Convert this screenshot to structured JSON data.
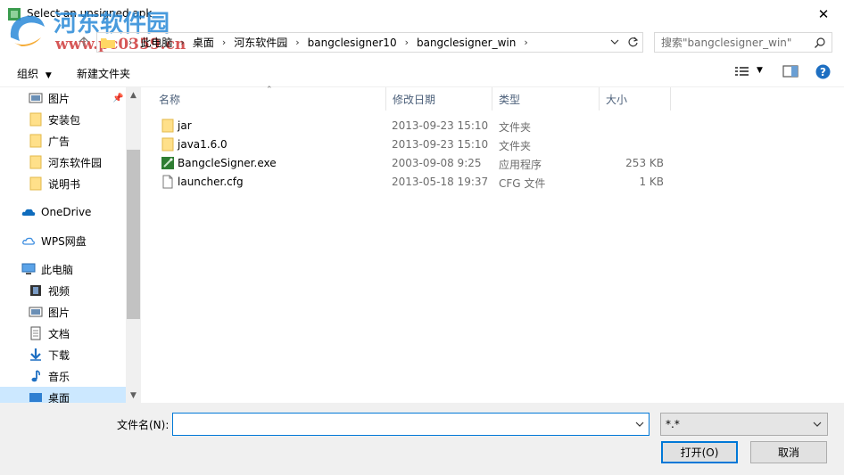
{
  "window": {
    "title": "Select an unsigned apk",
    "close_label": "✕"
  },
  "watermark": {
    "brand": "河东软件园",
    "url": "www.pc0359.cn"
  },
  "navigation": {
    "breadcrumbs": [
      "此电脑",
      "桌面",
      "河东软件园",
      "bangclesigner10",
      "bangclesigner_win"
    ],
    "search_placeholder": "搜索\"bangclesigner_win\""
  },
  "toolbar": {
    "organize_label": "组织",
    "new_folder_label": "新建文件夹"
  },
  "sidebar": {
    "items": [
      {
        "label": "图片",
        "icon": "pictures-icon"
      },
      {
        "label": "安装包",
        "icon": "folder-icon"
      },
      {
        "label": "广告",
        "icon": "folder-icon"
      },
      {
        "label": "河东软件园",
        "icon": "folder-icon"
      },
      {
        "label": "说明书",
        "icon": "folder-icon"
      },
      {
        "label": "OneDrive",
        "icon": "onedrive-icon"
      },
      {
        "label": "WPS网盘",
        "icon": "cloud-icon"
      },
      {
        "label": "此电脑",
        "icon": "computer-icon"
      },
      {
        "label": "视频",
        "icon": "video-icon"
      },
      {
        "label": "图片",
        "icon": "pictures-icon"
      },
      {
        "label": "文档",
        "icon": "documents-icon"
      },
      {
        "label": "下载",
        "icon": "download-icon"
      },
      {
        "label": "音乐",
        "icon": "music-icon"
      },
      {
        "label": "桌面",
        "icon": "desktop-icon"
      }
    ],
    "selected": "桌面"
  },
  "files": {
    "columns": [
      "名称",
      "修改日期",
      "类型",
      "大小"
    ],
    "rows": [
      {
        "name": "jar",
        "date": "2013-09-23 15:10",
        "type": "文件夹",
        "size": "",
        "icon": "folder-icon"
      },
      {
        "name": "java1.6.0",
        "date": "2013-09-23 15:10",
        "type": "文件夹",
        "size": "",
        "icon": "folder-icon"
      },
      {
        "name": "BangcleSigner.exe",
        "date": "2003-09-08 9:25",
        "type": "应用程序",
        "size": "253 KB",
        "icon": "exe-icon"
      },
      {
        "name": "launcher.cfg",
        "date": "2013-05-18 19:37",
        "type": "CFG 文件",
        "size": "1 KB",
        "icon": "file-icon"
      }
    ]
  },
  "footer": {
    "filename_label": "文件名(N):",
    "filename_value": "",
    "filetype_value": "*.*",
    "open_label": "打开(O)",
    "cancel_label": "取消"
  },
  "colors": {
    "accent": "#0078d7",
    "selected_bg": "#cce8ff",
    "folder": "#ffd764"
  }
}
